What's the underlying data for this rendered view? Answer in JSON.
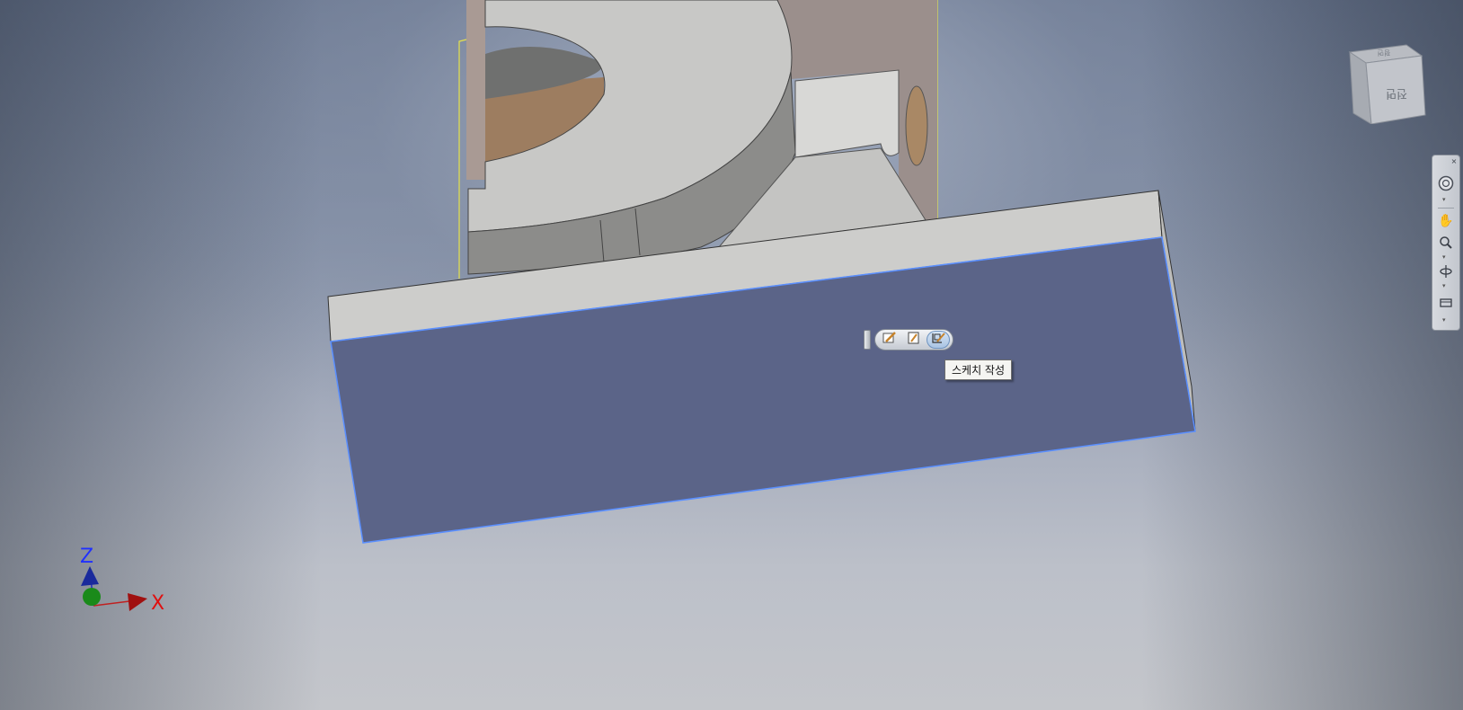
{
  "viewport": {
    "background_top": "#6b7891",
    "background_bottom": "#c4c6cb"
  },
  "model": {
    "selected_face_color": "#5b6488",
    "selected_edge_color": "#5a8fff",
    "body_color": "#cfcfcd",
    "highlight_outline_color": "#e6e24a"
  },
  "viewcube": {
    "face_text": "전면",
    "top_text": "평면"
  },
  "navigation_bar": {
    "items": [
      "steering-wheel",
      "pan",
      "zoom",
      "orbit",
      "look-at"
    ]
  },
  "mini_toolbar": {
    "buttons": [
      {
        "name": "edit-sketch",
        "active": false
      },
      {
        "name": "edit-feature",
        "active": false
      },
      {
        "name": "create-sketch",
        "active": true
      }
    ]
  },
  "tooltip": {
    "text": "스케치 작성"
  },
  "axis_triad": {
    "z_label": "Z",
    "x_label": "X"
  }
}
